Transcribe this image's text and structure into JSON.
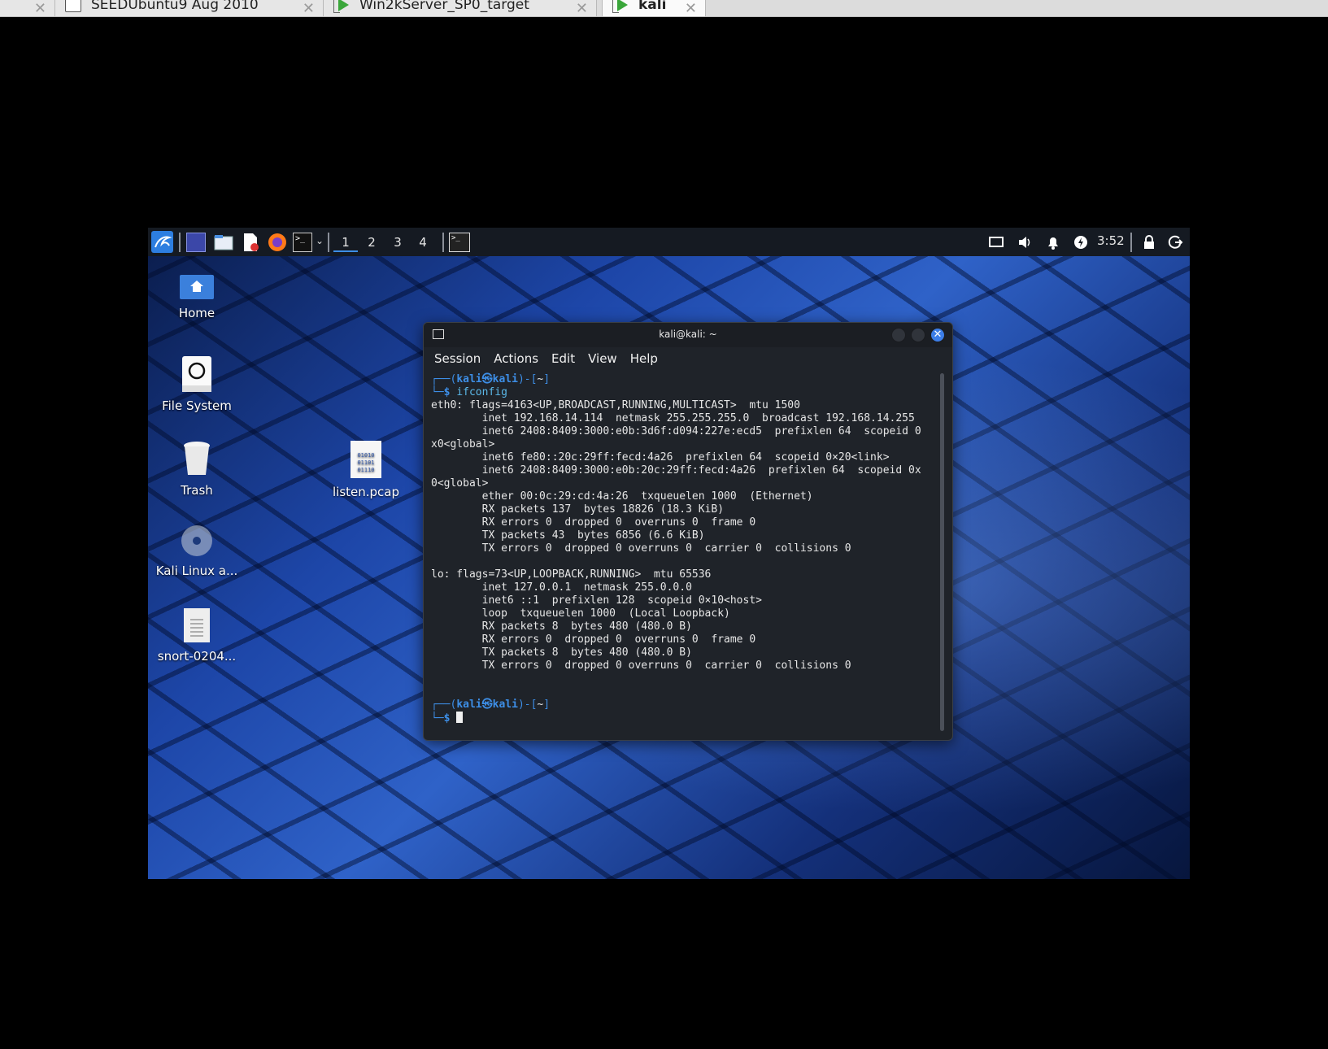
{
  "host_tabs": [
    {
      "label": "SEEDUbuntu9 Aug 2010",
      "active": false
    },
    {
      "label": "Win2kServer_SP0_target",
      "active": false
    },
    {
      "label": "kali",
      "active": true
    }
  ],
  "panel": {
    "workspaces": [
      "1",
      "2",
      "3",
      "4"
    ],
    "active_workspace": "1",
    "clock": "3:52"
  },
  "desktop_icons": [
    {
      "label": "Home",
      "icon": "home-folder-icon"
    },
    {
      "label": "File System",
      "icon": "drive-icon"
    },
    {
      "label": "Trash",
      "icon": "trash-icon"
    },
    {
      "label": "Kali Linux a...",
      "icon": "disc-icon"
    },
    {
      "label": "snort-0204...",
      "icon": "text-file-icon"
    },
    {
      "label": "listen.pcap",
      "icon": "binary-file-icon"
    }
  ],
  "terminal": {
    "title": "kali@kali: ~",
    "menu": [
      "Session",
      "Actions",
      "Edit",
      "View",
      "Help"
    ],
    "prompt_user": "kali㉿kali",
    "prompt_dir": "~",
    "command": "ifconfig",
    "output": [
      "eth0: flags=4163<UP,BROADCAST,RUNNING,MULTICAST>  mtu 1500",
      "        inet 192.168.14.114  netmask 255.255.255.0  broadcast 192.168.14.255",
      "        inet6 2408:8409:3000:e0b:3d6f:d094:227e:ecd5  prefixlen 64  scopeid 0",
      "x0<global>",
      "        inet6 fe80::20c:29ff:fecd:4a26  prefixlen 64  scopeid 0×20<link>",
      "        inet6 2408:8409:3000:e0b:20c:29ff:fecd:4a26  prefixlen 64  scopeid 0x",
      "0<global>",
      "        ether 00:0c:29:cd:4a:26  txqueuelen 1000  (Ethernet)",
      "        RX packets 137  bytes 18826 (18.3 KiB)",
      "        RX errors 0  dropped 0  overruns 0  frame 0",
      "        TX packets 43  bytes 6856 (6.6 KiB)",
      "        TX errors 0  dropped 0 overruns 0  carrier 0  collisions 0",
      "",
      "lo: flags=73<UP,LOOPBACK,RUNNING>  mtu 65536",
      "        inet 127.0.0.1  netmask 255.0.0.0",
      "        inet6 ::1  prefixlen 128  scopeid 0×10<host>",
      "        loop  txqueuelen 1000  (Local Loopback)",
      "        RX packets 8  bytes 480 (480.0 B)",
      "        RX errors 0  dropped 0  overruns 0  frame 0",
      "        TX packets 8  bytes 480 (480.0 B)",
      "        TX errors 0  dropped 0 overruns 0  carrier 0  collisions 0",
      "",
      ""
    ]
  }
}
